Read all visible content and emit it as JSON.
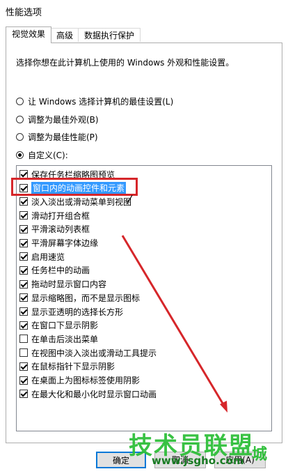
{
  "window": {
    "title": "性能选项"
  },
  "tabs": [
    {
      "label": "视觉效果",
      "active": true
    },
    {
      "label": "高级",
      "active": false
    },
    {
      "label": "数据执行保护",
      "active": false
    }
  ],
  "description": "选择你想在此计算机上使用的 Windows 外观和性能设置。",
  "radios": [
    {
      "label": "让 Windows 选择计算机的最佳设置(L)",
      "checked": false
    },
    {
      "label": "调整为最佳外观(B)",
      "checked": false
    },
    {
      "label": "调整为最佳性能(P)",
      "checked": false
    },
    {
      "label": "自定义(C):",
      "checked": true
    }
  ],
  "options": [
    {
      "label": "保存任务栏缩略图预览",
      "checked": true,
      "highlighted": false
    },
    {
      "label": "窗口内的动画控件和元素",
      "checked": true,
      "highlighted": true
    },
    {
      "label": "淡入淡出或滑动菜单到视图",
      "checked": true,
      "highlighted": false
    },
    {
      "label": "滑动打开组合框",
      "checked": true,
      "highlighted": false
    },
    {
      "label": "平滑滚动列表框",
      "checked": true,
      "highlighted": false
    },
    {
      "label": "平滑屏幕字体边缘",
      "checked": true,
      "highlighted": false
    },
    {
      "label": "启用速览",
      "checked": true,
      "highlighted": false
    },
    {
      "label": "任务栏中的动画",
      "checked": true,
      "highlighted": false
    },
    {
      "label": "拖动时显示窗口内容",
      "checked": true,
      "highlighted": false
    },
    {
      "label": "显示缩略图，而不是显示图标",
      "checked": true,
      "highlighted": false
    },
    {
      "label": "显示亚透明的选择长方形",
      "checked": true,
      "highlighted": false
    },
    {
      "label": "在窗口下显示阴影",
      "checked": true,
      "highlighted": false
    },
    {
      "label": "在单击后淡出菜单",
      "checked": false,
      "highlighted": false
    },
    {
      "label": "在视图中淡入淡出或滑动工具提示",
      "checked": false,
      "highlighted": false
    },
    {
      "label": "在鼠标指针下显示阴影",
      "checked": true,
      "highlighted": false
    },
    {
      "label": "在桌面上为图标标签使用阴影",
      "checked": true,
      "highlighted": false
    },
    {
      "label": "在最大化和最小化时显示窗口动画",
      "checked": true,
      "highlighted": false
    }
  ],
  "buttons": {
    "ok": "确定",
    "cancel": "取消",
    "apply": "应用(A)"
  },
  "watermark": {
    "text": "技术员联盟",
    "url": "www.jsgho.com",
    "suffix": "城"
  },
  "colors": {
    "highlight": "#3399ff",
    "annotation": "#d6262a",
    "watermark": "#2fbf3a"
  }
}
